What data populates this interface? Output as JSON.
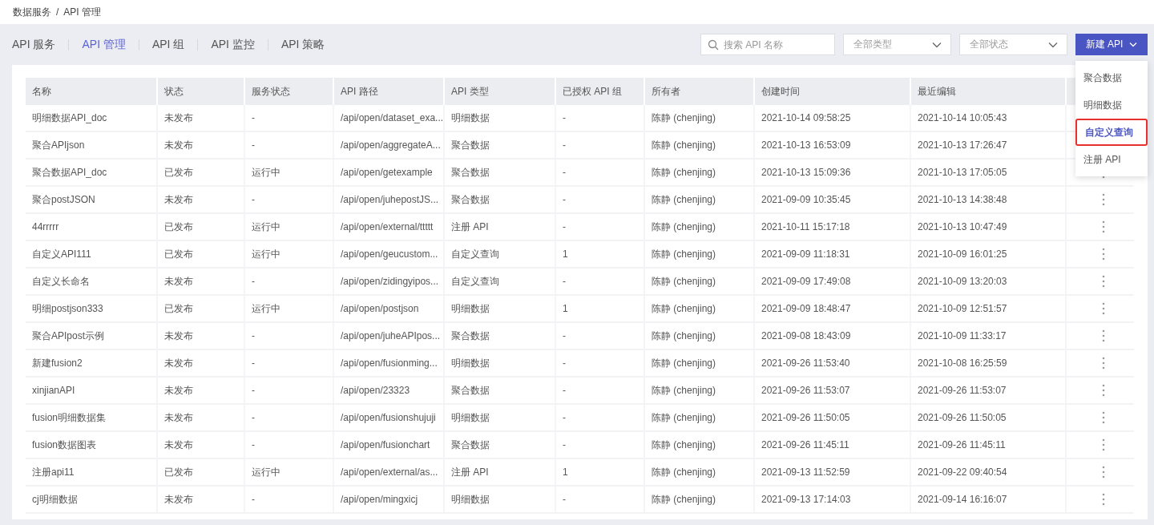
{
  "breadcrumb": [
    "数据服务",
    "/",
    "API 管理"
  ],
  "tabs": [
    {
      "label": "API 服务",
      "selected": false
    },
    {
      "label": "API 管理",
      "selected": true
    },
    {
      "label": "API 组",
      "selected": false
    },
    {
      "label": "API 监控",
      "selected": false
    },
    {
      "label": "API 策略",
      "selected": false
    }
  ],
  "search": {
    "placeholder": "搜索 API 名称"
  },
  "filters": [
    {
      "value": "全部类型"
    },
    {
      "value": "全部状态"
    }
  ],
  "new_button": {
    "label": "新建 API"
  },
  "new_menu": [
    {
      "label": "聚合数据",
      "selected": false
    },
    {
      "label": "明细数据",
      "selected": false
    },
    {
      "label": "自定义查询",
      "selected": true
    },
    {
      "label": "注册 API",
      "selected": false
    }
  ],
  "table": {
    "columns": [
      "名称",
      "状态",
      "服务状态",
      "API 路径",
      "API 类型",
      "已授权 API 组",
      "所有者",
      "创建时间",
      "最近编辑"
    ],
    "rows": [
      {
        "cells": [
          "明细数据API_doc",
          "未发布",
          "-",
          "/api/open/dataset_exa...",
          "明细数据",
          "-",
          "陈静 (chenjing)",
          "2021-10-14 09:58:25",
          "2021-10-14 10:05:43"
        ],
        "menu_button": false
      },
      {
        "cells": [
          "聚合APIjson",
          "未发布",
          "-",
          "/api/open/aggregateA...",
          "聚合数据",
          "-",
          "陈静 (chenjing)",
          "2021-10-13 16:53:09",
          "2021-10-13 17:26:47"
        ],
        "menu_button": false
      },
      {
        "cells": [
          "聚合数据API_doc",
          "已发布",
          "运行中",
          "/api/open/getexample",
          "聚合数据",
          "-",
          "陈静 (chenjing)",
          "2021-10-13 15:09:36",
          "2021-10-13 17:05:05"
        ],
        "menu_button": true
      },
      {
        "cells": [
          "聚合postJSON",
          "未发布",
          "-",
          "/api/open/juhepostJS...",
          "聚合数据",
          "-",
          "陈静 (chenjing)",
          "2021-09-09 10:35:45",
          "2021-10-13 14:38:48"
        ],
        "menu_button": true
      },
      {
        "cells": [
          "44rrrrr",
          "已发布",
          "运行中",
          "/api/open/external/ttttt",
          "注册 API",
          "-",
          "陈静 (chenjing)",
          "2021-10-11 15:17:18",
          "2021-10-13 10:47:49"
        ],
        "menu_button": true
      },
      {
        "cells": [
          "自定义API111",
          "已发布",
          "运行中",
          "/api/open/geucustom...",
          "自定义查询",
          "1",
          "陈静 (chenjing)",
          "2021-09-09 11:18:31",
          "2021-10-09 16:01:25"
        ],
        "menu_button": true
      },
      {
        "cells": [
          "自定义长命名",
          "未发布",
          "-",
          "/api/open/zidingyipos...",
          "自定义查询",
          "-",
          "陈静 (chenjing)",
          "2021-09-09 17:49:08",
          "2021-10-09 13:20:03"
        ],
        "menu_button": true
      },
      {
        "cells": [
          "明细postjson333",
          "已发布",
          "运行中",
          "/api/open/postjson",
          "明细数据",
          "1",
          "陈静 (chenjing)",
          "2021-09-09 18:48:47",
          "2021-10-09 12:51:57"
        ],
        "menu_button": true
      },
      {
        "cells": [
          "聚合APIpost示例",
          "未发布",
          "-",
          "/api/open/juheAPIpos...",
          "聚合数据",
          "-",
          "陈静 (chenjing)",
          "2021-09-08 18:43:09",
          "2021-10-09 11:33:17"
        ],
        "menu_button": true
      },
      {
        "cells": [
          "新建fusion2",
          "未发布",
          "-",
          "/api/open/fusionming...",
          "明细数据",
          "-",
          "陈静 (chenjing)",
          "2021-09-26 11:53:40",
          "2021-10-08 16:25:59"
        ],
        "menu_button": true
      },
      {
        "cells": [
          "xinjianAPI",
          "未发布",
          "-",
          "/api/open/23323",
          "聚合数据",
          "-",
          "陈静 (chenjing)",
          "2021-09-26 11:53:07",
          "2021-09-26 11:53:07"
        ],
        "menu_button": true
      },
      {
        "cells": [
          "fusion明细数据集",
          "未发布",
          "-",
          "/api/open/fusionshujuji",
          "明细数据",
          "-",
          "陈静 (chenjing)",
          "2021-09-26 11:50:05",
          "2021-09-26 11:50:05"
        ],
        "menu_button": true
      },
      {
        "cells": [
          "fusion数据图表",
          "未发布",
          "-",
          "/api/open/fusionchart",
          "聚合数据",
          "-",
          "陈静 (chenjing)",
          "2021-09-26 11:45:11",
          "2021-09-26 11:45:11"
        ],
        "menu_button": true
      },
      {
        "cells": [
          "注册api11",
          "已发布",
          "运行中",
          "/api/open/external/as...",
          "注册 API",
          "1",
          "陈静 (chenjing)",
          "2021-09-13 11:52:59",
          "2021-09-22 09:40:54"
        ],
        "menu_button": true
      },
      {
        "cells": [
          "cj明细数据",
          "未发布",
          "-",
          "/api/open/mingxicj",
          "明细数据",
          "-",
          "陈静 (chenjing)",
          "2021-09-13 17:14:03",
          "2021-09-14 16:16:07"
        ],
        "menu_button": true
      }
    ]
  }
}
